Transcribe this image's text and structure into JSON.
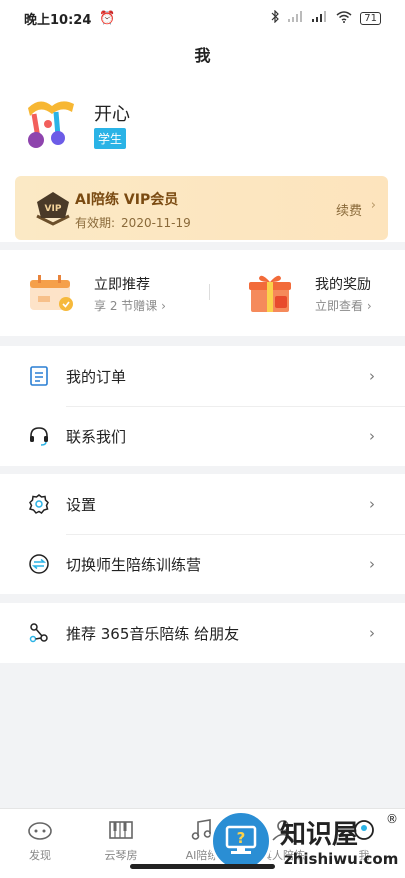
{
  "status_bar": {
    "time": "晚上10:24",
    "battery": "71"
  },
  "header": {
    "title": "我"
  },
  "profile": {
    "name": "开心",
    "role": "学生"
  },
  "vip": {
    "title": "AI陪练 VIP会员",
    "expiry_label": "有效期:",
    "expiry_date": "2020-11-19",
    "renew_label": "续费"
  },
  "promo": [
    {
      "title": "立即推荐",
      "subtitle": "享 2 节赠课"
    },
    {
      "title": "我的奖励",
      "subtitle": "立即查看"
    }
  ],
  "menu_groups": [
    [
      {
        "label": "我的订单"
      },
      {
        "label": "联系我们"
      }
    ],
    [
      {
        "label": "设置"
      },
      {
        "label": "切换师生陪练训练营"
      }
    ],
    [
      {
        "label": "推荐 365音乐陪练 给朋友"
      }
    ]
  ],
  "tabs": [
    {
      "label": "发现"
    },
    {
      "label": "云琴房"
    },
    {
      "label": "AI陪练"
    },
    {
      "label": "真人陪练"
    },
    {
      "label": "我"
    }
  ],
  "watermark": {
    "text": "知识屋",
    "url": "zhishiwu.com"
  },
  "colors": {
    "badge": "#2ab3e6",
    "vip_text": "#7a4a11",
    "vip_bg": "#fbe9c5",
    "watermark_blue": "#2a8ed4"
  }
}
